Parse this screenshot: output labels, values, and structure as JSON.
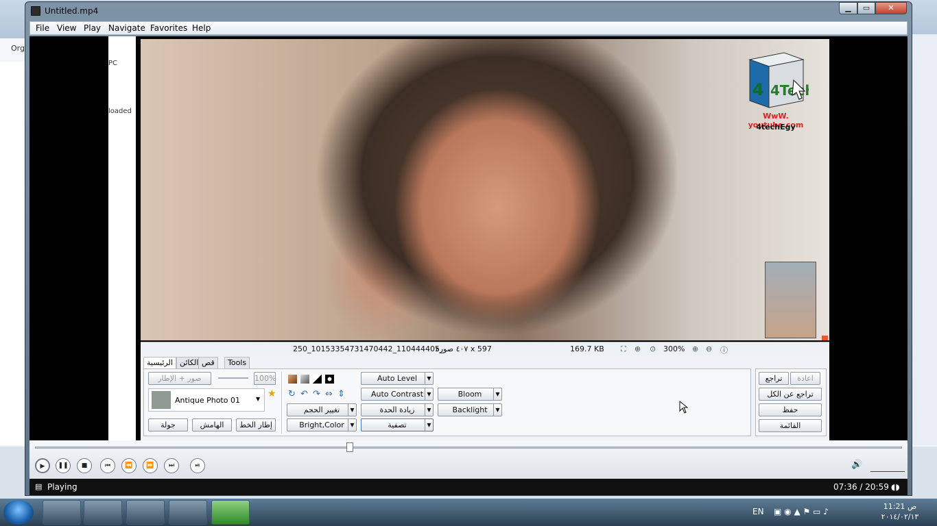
{
  "window": {
    "title": "Untitled.mp4",
    "min": "▁",
    "max": "▭",
    "close": "✕"
  },
  "menu": [
    "File",
    "View",
    "Play",
    "Navigate",
    "Favorites",
    "Help"
  ],
  "background": {
    "org": "Org",
    "left_text1": "PC",
    "left_text2": "loaded"
  },
  "overlay_logo": {
    "brand": "4Tech",
    "url": "WwW. youtube.com",
    "handle": "4techEgy"
  },
  "image_status": {
    "filename": "250_10153354731470442_110444405_",
    "dimensions": "٤٠٧ صورة x 597",
    "filesize": "169.7 KB",
    "zoom": "300%"
  },
  "tabs": [
    "الرئيسية",
    "الكائن",
    "قص",
    "Tools"
  ],
  "editor": {
    "frame_label": "صور + الإطار",
    "opacity": "100%",
    "preset": "Antique Photo 01",
    "btn_tour": "جولة",
    "btn_margin": "الهامش",
    "btn_line_frame": "إطار الخط",
    "btn_resize": "تغيير الحجم",
    "btn_bright_color": "Bright,Color",
    "btn_auto_level": "Auto Level",
    "btn_auto_contrast": "Auto Contrast",
    "btn_sharpen": "زيادة الحدة",
    "btn_filter": "تصفية",
    "btn_bloom": "Bloom",
    "btn_backlight": "Backlight",
    "btn_undo": "تراجع",
    "btn_redo": "اعادة",
    "btn_undo_all": "تراجع عن الكل",
    "btn_save": "حفظ",
    "btn_list": "القائمة"
  },
  "status": {
    "state": "Playing",
    "time": "07:36 / 20:59"
  },
  "tray": {
    "lang": "EN",
    "time": "11:21 ص",
    "date": "٢٠١٤/٠٢/١٣"
  }
}
